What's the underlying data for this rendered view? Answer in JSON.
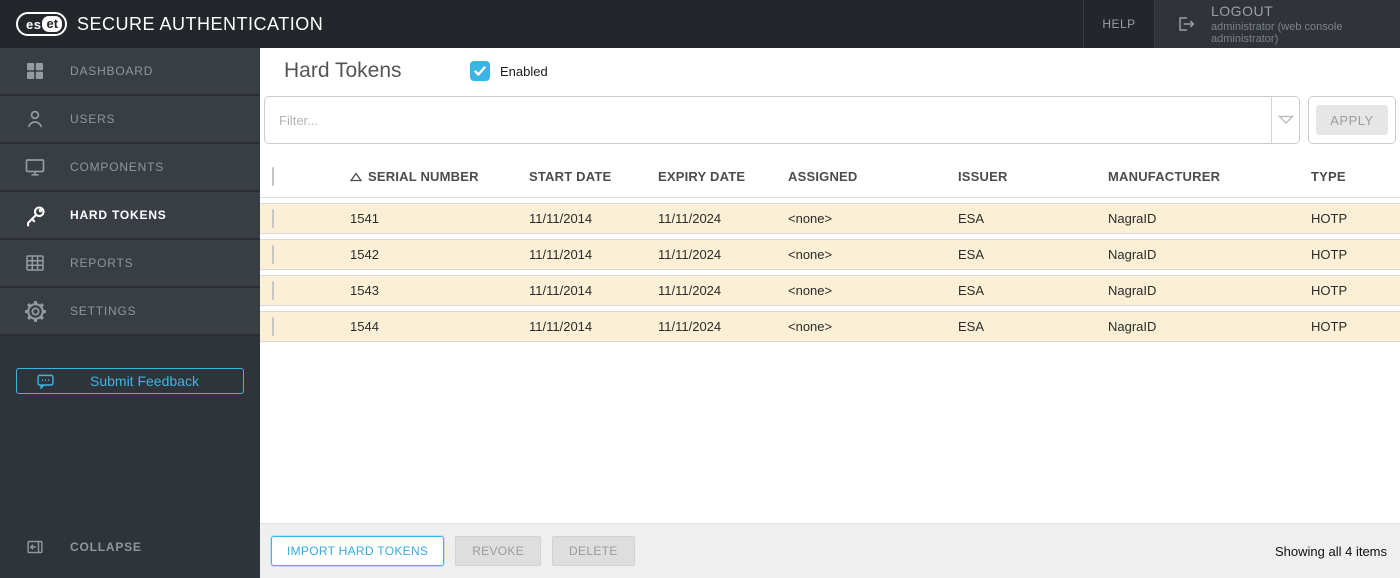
{
  "topbar": {
    "logo_left": "es",
    "logo_right": "et",
    "app_title": "SECURE AUTHENTICATION",
    "help_label": "HELP",
    "logout_label": "LOGOUT",
    "logout_sub": "administrator (web console administrator)"
  },
  "sidebar": {
    "items": [
      {
        "label": "DASHBOARD",
        "icon": "dashboard-icon",
        "active": false
      },
      {
        "label": "USERS",
        "icon": "users-icon",
        "active": false
      },
      {
        "label": "COMPONENTS",
        "icon": "monitor-icon",
        "active": false
      },
      {
        "label": "HARD TOKENS",
        "icon": "key-icon",
        "active": true
      },
      {
        "label": "REPORTS",
        "icon": "reports-icon",
        "active": false
      },
      {
        "label": "SETTINGS",
        "icon": "gear-icon",
        "active": false
      }
    ],
    "feedback_label": "Submit Feedback",
    "collapse_label": "COLLAPSE"
  },
  "main": {
    "title": "Hard Tokens",
    "enabled_label": "Enabled",
    "enabled_checked": true,
    "filter_placeholder": "Filter...",
    "apply_label": "APPLY"
  },
  "table": {
    "columns": [
      "SERIAL NUMBER",
      "START DATE",
      "EXPIRY DATE",
      "ASSIGNED",
      "ISSUER",
      "MANUFACTURER",
      "TYPE"
    ],
    "sort_column": "SERIAL NUMBER",
    "sort_direction": "ascending",
    "rows": [
      {
        "serial": "1541",
        "start": "11/11/2014",
        "expiry": "11/11/2024",
        "assigned": "<none>",
        "issuer": "ESA",
        "manufacturer": "NagraID",
        "type": "HOTP"
      },
      {
        "serial": "1542",
        "start": "11/11/2014",
        "expiry": "11/11/2024",
        "assigned": "<none>",
        "issuer": "ESA",
        "manufacturer": "NagraID",
        "type": "HOTP"
      },
      {
        "serial": "1543",
        "start": "11/11/2014",
        "expiry": "11/11/2024",
        "assigned": "<none>",
        "issuer": "ESA",
        "manufacturer": "NagraID",
        "type": "HOTP"
      },
      {
        "serial": "1544",
        "start": "11/11/2014",
        "expiry": "11/11/2024",
        "assigned": "<none>",
        "issuer": "ESA",
        "manufacturer": "NagraID",
        "type": "HOTP"
      }
    ]
  },
  "footer": {
    "import_label": "IMPORT HARD TOKENS",
    "revoke_label": "REVOKE",
    "delete_label": "DELETE",
    "status": "Showing all 4 items"
  },
  "colors": {
    "accent_blue": "#3cb4e5",
    "topbar_bg": "#23262b",
    "sidebar_bg": "#2f343a",
    "sidebar_item_bg": "#393e45",
    "row_bg": "#fbf0d5",
    "footer_bg": "#efefef"
  }
}
